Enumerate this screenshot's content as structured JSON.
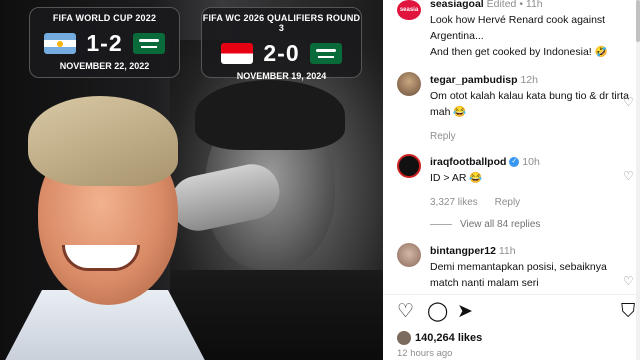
{
  "post_image": {
    "card1": {
      "title": "FIFA WORLD CUP 2022",
      "score": "1-2",
      "date": "NOVEMBER 22, 2022",
      "home_flag": "argentina-flag",
      "away_flag": "saudi-arabia-flag"
    },
    "card2": {
      "title": "FIFA WC 2026 QUALIFIERS ROUND 3",
      "score": "2-0",
      "date": "NOVEMBER 19, 2024",
      "home_flag": "indonesia-flag",
      "away_flag": "saudi-arabia-flag"
    }
  },
  "caption": {
    "avatar_text": "seasia",
    "username": "seasiagoal",
    "meta": "Edited • 11h",
    "line1": "Look how Hervé Renard cook against",
    "line2": "Argentina...",
    "line3": "And then get cooked by Indonesia! 🤣"
  },
  "comments": [
    {
      "username": "tegar_pambudisp",
      "time": "12h",
      "text": "Om otot kalah kalau kata bung tio & dr tirta mah 😂",
      "reply_label": "Reply",
      "likes": ""
    },
    {
      "username": "iraqfootballpod",
      "verified": true,
      "time": "10h",
      "text": "ID > AR 😂",
      "likes": "3,327 likes",
      "reply_label": "Reply",
      "view_replies": "View all 84 replies"
    },
    {
      "username": "bintangper12",
      "time": "11h",
      "text": "Demi memantapkan posisi, sebaiknya match nanti malam seri"
    }
  ],
  "actions": {
    "like_icon": "heart-icon",
    "comment_icon": "comment-icon",
    "share_icon": "share-icon",
    "save_icon": "bookmark-icon"
  },
  "likes_count": "140,264 likes",
  "time_ago": "12 hours ago"
}
